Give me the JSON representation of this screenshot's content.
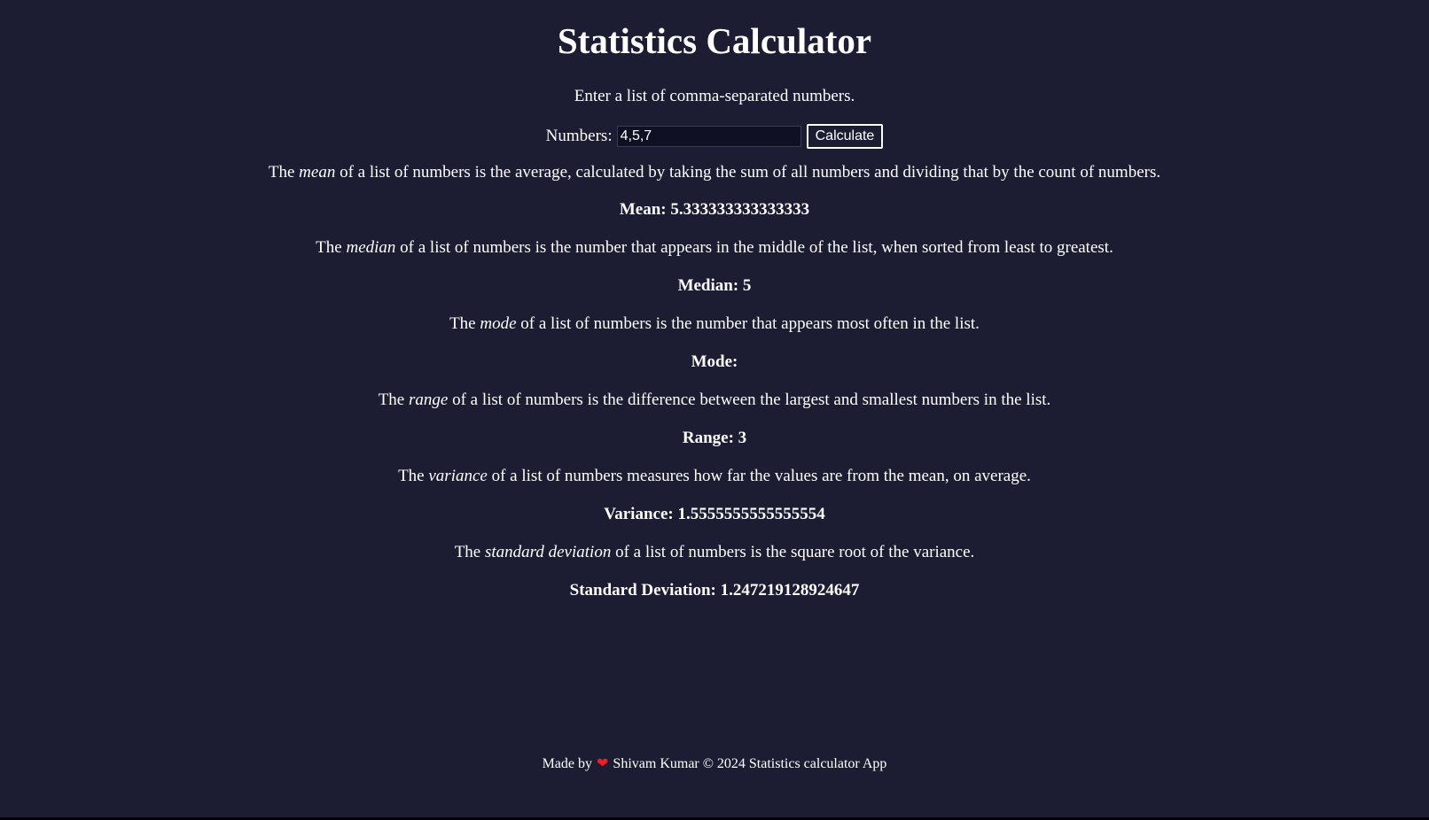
{
  "header": {
    "title": "Statistics Calculator",
    "intro": "Enter a list of comma-separated numbers."
  },
  "form": {
    "label": "Numbers:",
    "value": "4,5,7",
    "button_label": "Calculate"
  },
  "stats": {
    "mean": {
      "desc_before": "The ",
      "term": "mean",
      "desc_after": " of a list of numbers is the average, calculated by taking the sum of all numbers and dividing that by the count of numbers.",
      "result": "Mean: 5.333333333333333"
    },
    "median": {
      "desc_before": "The ",
      "term": "median",
      "desc_after": " of a list of numbers is the number that appears in the middle of the list, when sorted from least to greatest.",
      "result": "Median: 5"
    },
    "mode": {
      "desc_before": "The ",
      "term": "mode",
      "desc_after": " of a list of numbers is the number that appears most often in the list.",
      "result": "Mode:"
    },
    "range": {
      "desc_before": "The ",
      "term": "range",
      "desc_after": " of a list of numbers is the difference between the largest and smallest numbers in the list.",
      "result": "Range: 3"
    },
    "variance": {
      "desc_before": "The ",
      "term": "variance",
      "desc_after": " of a list of numbers measures how far the values are from the mean, on average.",
      "result": "Variance: 1.5555555555555554"
    },
    "std_dev": {
      "desc_before": "The ",
      "term": "standard deviation",
      "desc_after": " of a list of numbers is the square root of the variance.",
      "result": "Standard Deviation: 1.247219128924647"
    }
  },
  "footer": {
    "made_by": "Made by",
    "heart_icon": "heart-icon",
    "heart_glyph": "❤",
    "credit": "Shivam Kumar © 2024 Statistics calculator App"
  },
  "colors": {
    "background": "#1c1d33",
    "text": "#ffffff",
    "heart": "#e8202a"
  }
}
